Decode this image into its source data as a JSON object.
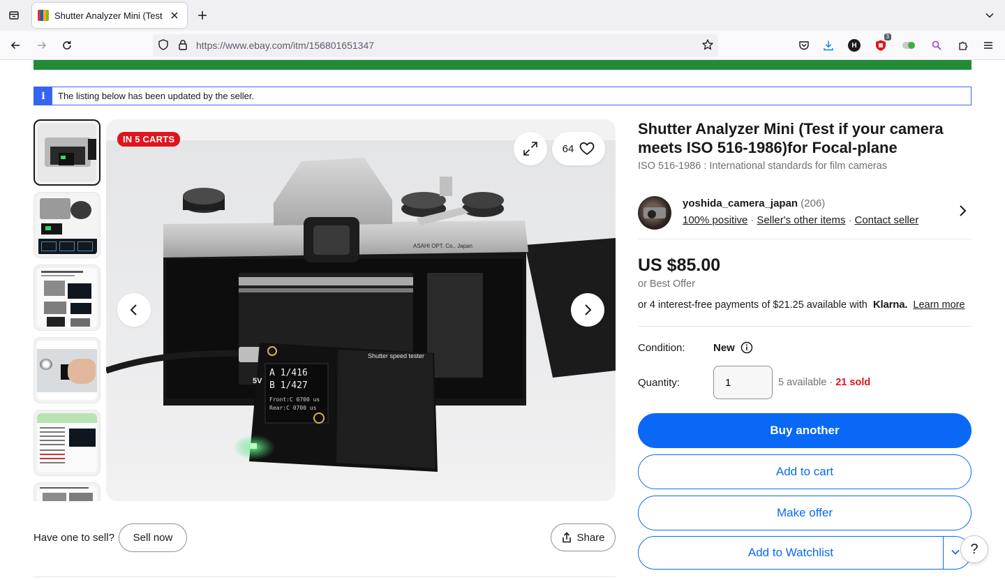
{
  "browser": {
    "tab_title": "Shutter Analyzer Mini (Test",
    "url_host": "https://www.ebay.com",
    "url_path": "/itm/156801651347",
    "extension_badge": "3",
    "ext_h_letter": "H"
  },
  "notice": {
    "icon": "i",
    "text": "The listing below has been updated by the seller."
  },
  "gallery": {
    "badge": "IN 5 CARTS",
    "watch_count": "64"
  },
  "below": {
    "have_one": "Have one to sell?",
    "sell_now": "Sell now",
    "share": "Share"
  },
  "listing": {
    "title": "Shutter Analyzer Mini (Test if your camera meets ISO 516-1986)for Focal-plane",
    "subtitle": "ISO 516-1986 : International standards for film cameras"
  },
  "seller": {
    "name": "yoshida_camera_japan",
    "feedback_count": "(206)",
    "positive": "100% positive",
    "other_items": "Seller's other items",
    "contact": "Contact seller"
  },
  "pricing": {
    "price": "US $85.00",
    "best_offer": "or Best Offer",
    "installments_text": "or 4 interest-free payments of $21.25 available with",
    "klarna": "Klarna.",
    "learn_more": "Learn more"
  },
  "condition": {
    "label": "Condition:",
    "value": "New"
  },
  "quantity": {
    "label": "Quantity:",
    "value": "1",
    "available": "5 available",
    "separator": "·",
    "sold": "21 sold"
  },
  "actions": {
    "buy": "Buy another",
    "cart": "Add to cart",
    "offer": "Make offer",
    "watchlist": "Add to Watchlist"
  },
  "help": "?",
  "colors": {
    "primary_blue": "#0968f6",
    "green_bar": "#218c35",
    "sold_red": "#e0141c",
    "notice_blue": "#3665f3"
  }
}
